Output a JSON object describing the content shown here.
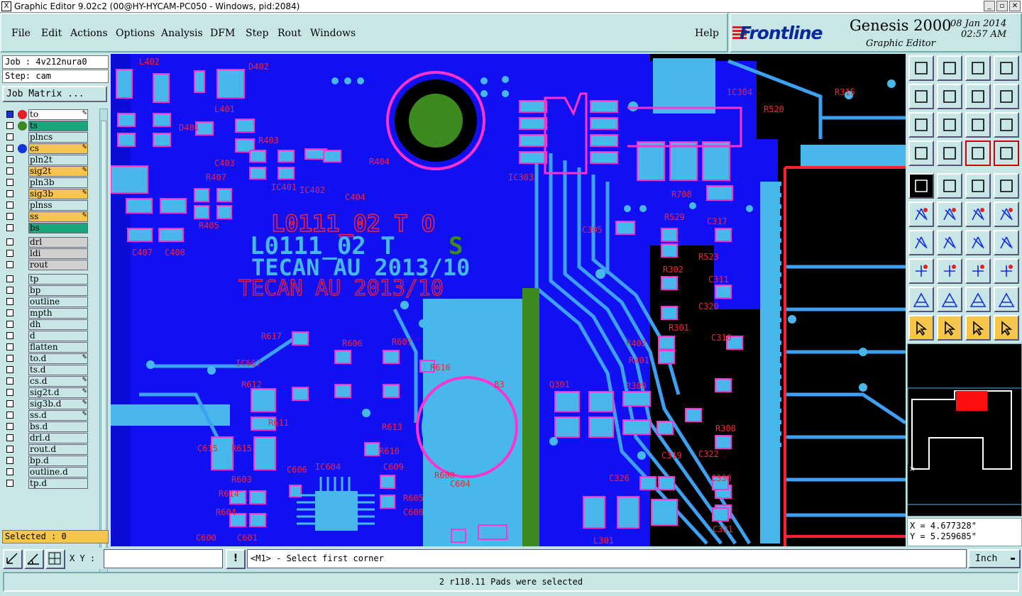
{
  "window": {
    "title": "Graphic Editor 9.02c2 (00@HY-HYCAM-PC050 - Windows, pid:2084)",
    "min_glyph": "_",
    "max_glyph": "▫",
    "close_glyph": "✕"
  },
  "menu": [
    "File",
    "Edit",
    "Actions",
    "Options",
    "Analysis",
    "DFM",
    "Step",
    "Rout",
    "Windows"
  ],
  "help_label": "Help",
  "brand": {
    "logo": "Frontline",
    "product": "Genesis 2000",
    "subtitle": "Graphic Editor",
    "date": "08 Jan 2014",
    "time": "02:57 AM"
  },
  "job": {
    "job_text": "Job : 4v212nura0",
    "step_text": "Step: cam",
    "matrix_label": "Job Matrix ..."
  },
  "layers": [
    {
      "name": "to",
      "dot": "#e62020",
      "bg": "#ffffff",
      "edit": true,
      "sel": true
    },
    {
      "name": "ts",
      "dot": "#3c8a1e",
      "bg": "#1aa67c",
      "edit": false
    },
    {
      "name": "plncs",
      "dot": "",
      "bg": "#c8e6e6",
      "edit": false
    },
    {
      "name": "cs",
      "dot": "#1430e0",
      "bg": "#f5c64c",
      "edit": true
    },
    {
      "name": "pln2t",
      "dot": "",
      "bg": "#c8e6e6",
      "edit": false
    },
    {
      "name": "sig2t",
      "dot": "",
      "bg": "#f5c64c",
      "edit": true
    },
    {
      "name": "pln3b",
      "dot": "",
      "bg": "#c8e6e6",
      "edit": false
    },
    {
      "name": "sig3b",
      "dot": "",
      "bg": "#f5c64c",
      "edit": true
    },
    {
      "name": "plnss",
      "dot": "",
      "bg": "#c8e6e6",
      "edit": false
    },
    {
      "name": "ss",
      "dot": "",
      "bg": "#f5c64c",
      "edit": true
    },
    {
      "name": "bs",
      "dot": "",
      "bg": "#1aa67c",
      "edit": false
    },
    {
      "name": "drl",
      "dot": "",
      "bg": "#d0d0d0",
      "edit": false
    },
    {
      "name": "ldi",
      "dot": "",
      "bg": "#d0d0d0",
      "edit": false
    },
    {
      "name": "rout",
      "dot": "",
      "bg": "#d0d0d0",
      "edit": false
    },
    {
      "name": "tp",
      "dot": "",
      "bg": "#c8e6e6",
      "edit": false
    },
    {
      "name": "bp",
      "dot": "",
      "bg": "#c8e6e6",
      "edit": false
    },
    {
      "name": "outline",
      "dot": "",
      "bg": "#c8e6e6",
      "edit": false
    },
    {
      "name": "mpth",
      "dot": "",
      "bg": "#c8e6e6",
      "edit": false
    },
    {
      "name": "dh",
      "dot": "",
      "bg": "#c8e6e6",
      "edit": false
    },
    {
      "name": "d",
      "dot": "",
      "bg": "#c8e6e6",
      "edit": false
    },
    {
      "name": "flatten",
      "dot": "",
      "bg": "#c8e6e6",
      "edit": false
    },
    {
      "name": "to.d",
      "dot": "",
      "bg": "#c8e6e6",
      "edit": true
    },
    {
      "name": "ts.d",
      "dot": "",
      "bg": "#c8e6e6",
      "edit": false
    },
    {
      "name": "cs.d",
      "dot": "",
      "bg": "#c8e6e6",
      "edit": true
    },
    {
      "name": "sig2t.d",
      "dot": "",
      "bg": "#c8e6e6",
      "edit": true
    },
    {
      "name": "sig3b.d",
      "dot": "",
      "bg": "#c8e6e6",
      "edit": true
    },
    {
      "name": "ss.d",
      "dot": "",
      "bg": "#c8e6e6",
      "edit": true
    },
    {
      "name": "bs.d",
      "dot": "",
      "bg": "#c8e6e6",
      "edit": false
    },
    {
      "name": "drl.d",
      "dot": "",
      "bg": "#c8e6e6",
      "edit": false
    },
    {
      "name": "rout.d",
      "dot": "",
      "bg": "#c8e6e6",
      "edit": false
    },
    {
      "name": "bp.d",
      "dot": "",
      "bg": "#c8e6e6",
      "edit": false
    },
    {
      "name": "outline.d",
      "dot": "",
      "bg": "#c8e6e6",
      "edit": false
    },
    {
      "name": "tp.d",
      "dot": "",
      "bg": "#c8e6e6",
      "edit": false
    }
  ],
  "edit_glyph": "✎",
  "selected_text": "Selected : 0",
  "board_text": {
    "marking_top": "L0111_02 T  O",
    "marking_mid": "L0111_02 T",
    "marking_l": "L",
    "marking_s": "S",
    "tecan_1": "TECAN AU 2013/10",
    "tecan_2": "TECAN AU 2013/10",
    "refdes": [
      "L402",
      "D402",
      "L401",
      "D401",
      "R403",
      "C403",
      "R404",
      "R407",
      "IC402",
      "IC401",
      "C404",
      "R405",
      "C407",
      "C408",
      "IC303",
      "IC304",
      "R708",
      "C305",
      "R529",
      "C317",
      "R523",
      "R302",
      "C311",
      "C320",
      "R301",
      "C310",
      "R402",
      "R401",
      "R617",
      "R606",
      "R607",
      "R616",
      "IC607",
      "R612",
      "R614",
      "R611",
      "R613",
      "R615",
      "B3",
      "R610",
      "C609",
      "C615",
      "C606",
      "IC604",
      "R603",
      "R608",
      "C604",
      "R605",
      "C608",
      "R604",
      "C601",
      "C600",
      "Q301",
      "R309",
      "R308",
      "C322",
      "C319",
      "C326",
      "C330",
      "C321",
      "L301",
      "R315",
      "R520"
    ]
  },
  "coords": {
    "x": "X = 4.677328\"",
    "y": "Y = 5.259685\""
  },
  "bottom": {
    "xy_label": "X Y :",
    "xy_value": "",
    "info_glyph": "!",
    "prompt": "<M1> - Select first corner",
    "units": "Inch",
    "units_glyph": "▬"
  },
  "status_text": "2 r118.11 Pads were selected",
  "colors": {
    "board_blue": "#1010f0",
    "copper_cyan": "#48b8ec",
    "silk_magenta": "#ff33cc",
    "silk_red": "#ff2030",
    "mask_green": "#3c8a1e",
    "panel": "#c8e6e6",
    "highlight_orange": "#f5c64c"
  }
}
